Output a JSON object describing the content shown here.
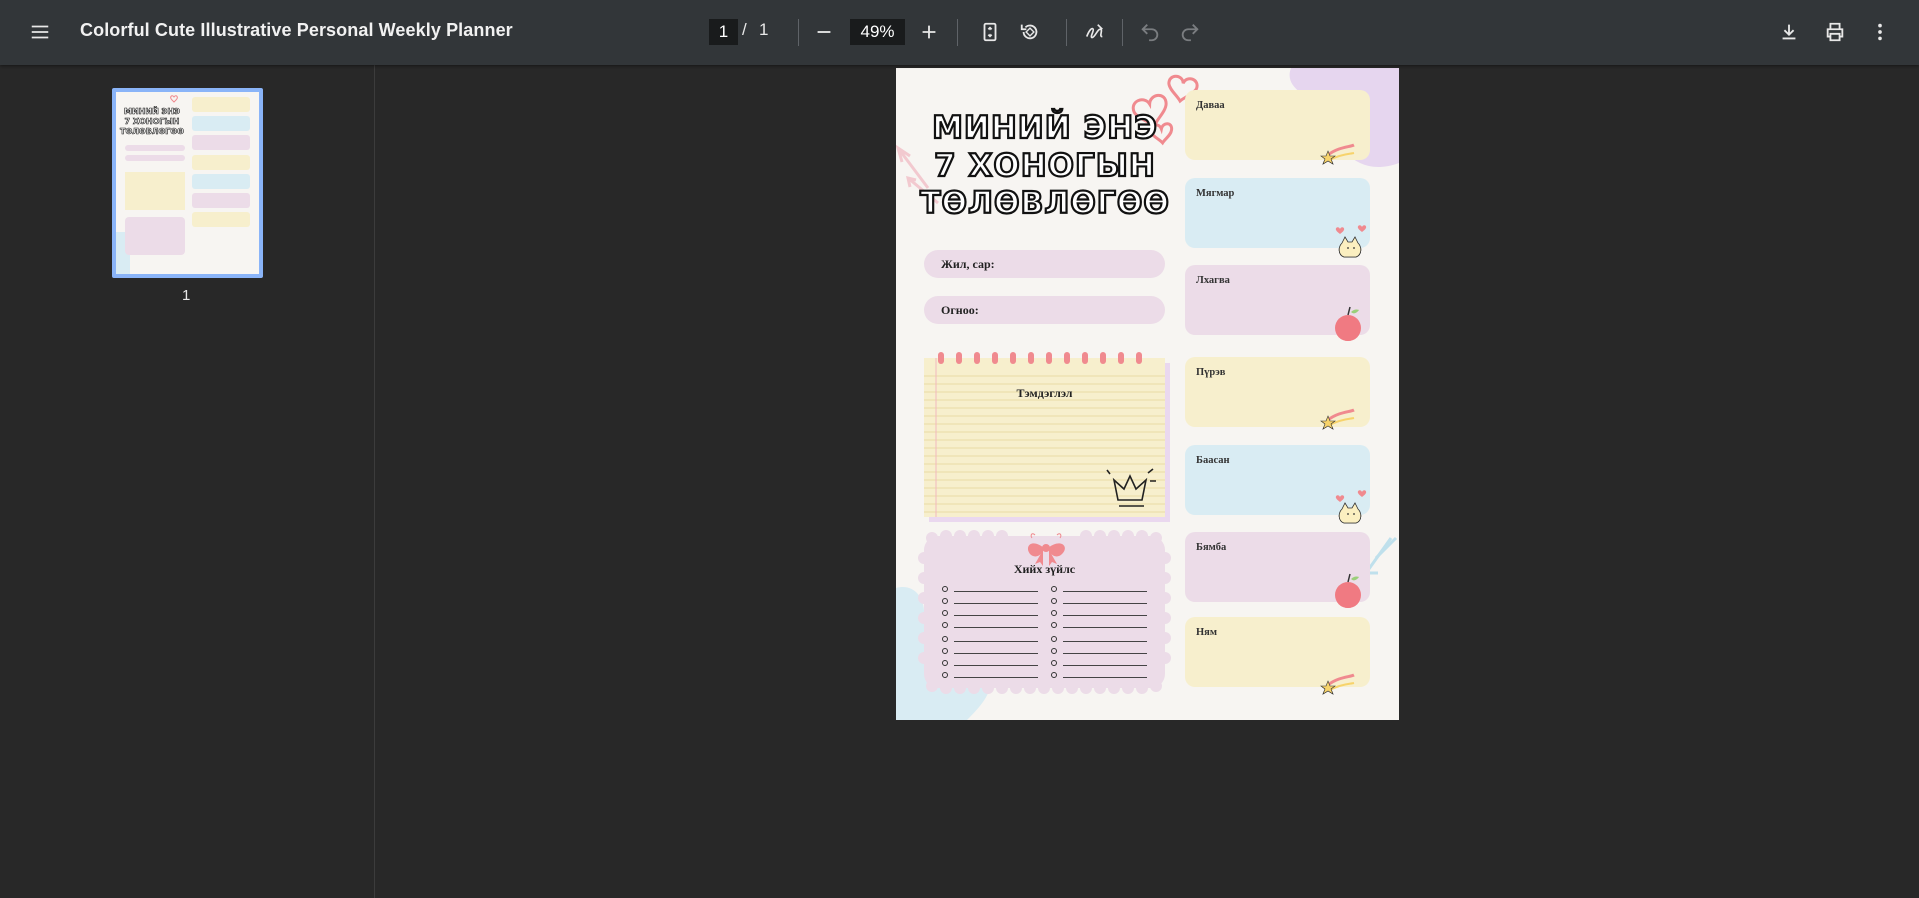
{
  "toolbar": {
    "menu_icon": "hamburger-menu-icon",
    "title": "Colorful Cute Illustrative Personal Weekly Planner",
    "page_current": "1",
    "page_separator": "/",
    "page_total": "1",
    "zoom": "49%",
    "icons": [
      "minus-icon",
      "plus-icon",
      "fit-page-icon",
      "rotate-icon",
      "annotate-pen-icon",
      "undo-icon",
      "redo-icon",
      "download-icon",
      "print-icon",
      "more-vert-icon"
    ]
  },
  "sidebar": {
    "thumbnails": [
      {
        "label": "1"
      }
    ]
  },
  "planner": {
    "title_lines": [
      "МИНИЙ ЭНЭ",
      "7 ХОНОГЫН",
      "ТӨЛӨВЛӨГӨӨ"
    ],
    "fields": [
      "Жил, сар:",
      "Огноо:"
    ],
    "notes_title": "Тэмдэглэл",
    "todo_title": "Хийх зүйлс",
    "days": [
      "Даваа",
      "Мягмар",
      "Лхагва",
      "Пүрэв",
      "Баасан",
      "Бямба",
      "Ням"
    ],
    "colors": {
      "yellow": "#f7efcd",
      "blue": "#d9ecf3",
      "pink": "#ecdce8",
      "accent_pink": "#f08a8f",
      "lavender": "#e6d6ef"
    }
  }
}
